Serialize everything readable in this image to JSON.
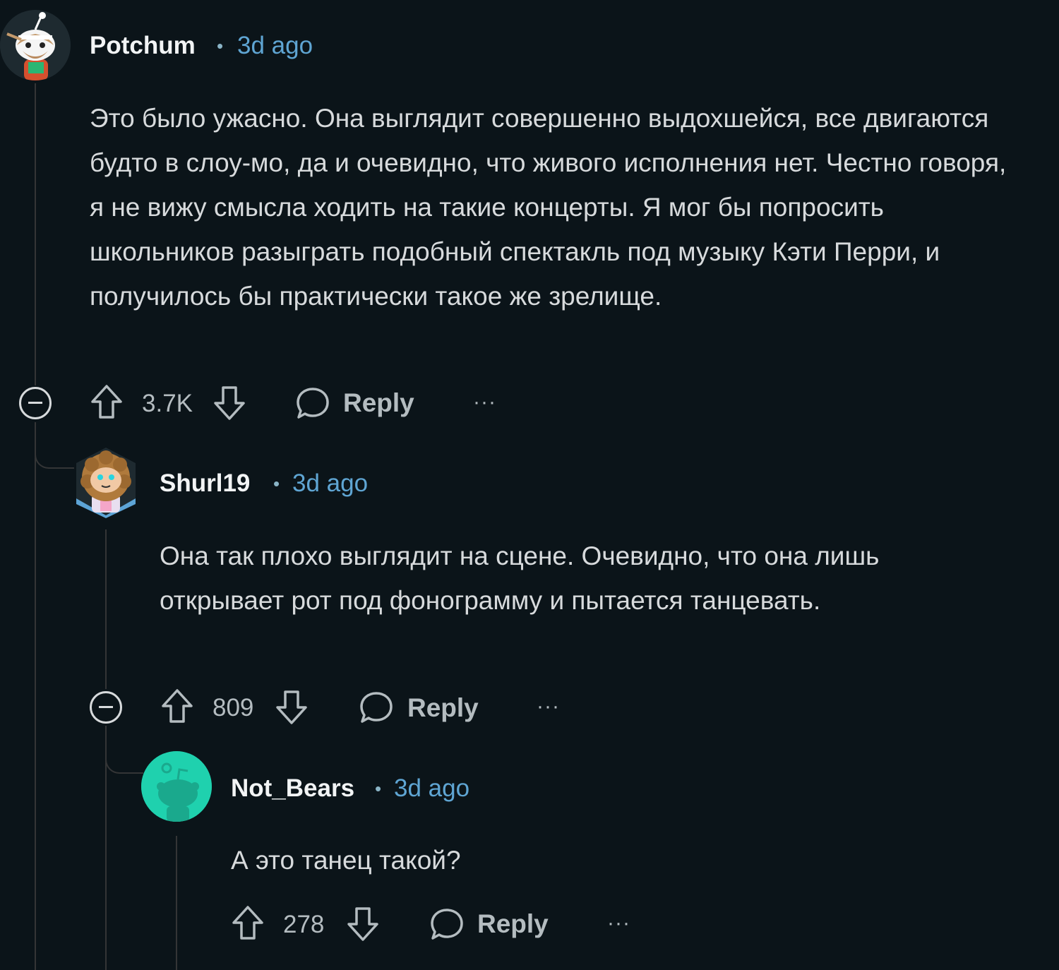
{
  "comments": [
    {
      "username": "Potchum",
      "separator": "•",
      "time": "3d ago",
      "body": "Это было ужасно. Она выглядит совершенно выдохшейся, все двигаются будто в слоу-мо, да и очевидно, что живого исполнения нет. Честно говоря, я не вижу смысла ходить на такие концерты. Я мог бы попросить школьников разыграть подобный спектакль под музыку Кэти Перри, и получилось бы практически такое же зрелище.",
      "votes": "3.7K",
      "reply_label": "Reply",
      "more_label": "···"
    },
    {
      "username": "Shurl19",
      "separator": "•",
      "time": "3d ago",
      "body": "Она так плохо выглядит на сцене. Очевидно, что она лишь открывает рот под фонограмму и пытается танцевать.",
      "votes": "809",
      "reply_label": "Reply",
      "more_label": "···"
    },
    {
      "username": "Not_Bears",
      "separator": "•",
      "time": "3d ago",
      "body": "А это танец такой?",
      "votes": "278",
      "reply_label": "Reply",
      "more_label": "···"
    }
  ],
  "icons": {
    "upvote": "arrow-up-outline",
    "downvote": "arrow-down-outline",
    "reply": "speech-bubble",
    "collapse": "minus-circle",
    "avatar_default": "reddit-snoo"
  },
  "colors": {
    "background": "#0b1419",
    "timestamp": "#5fa5d3",
    "default_avatar_bg": "#1fd1ae"
  }
}
